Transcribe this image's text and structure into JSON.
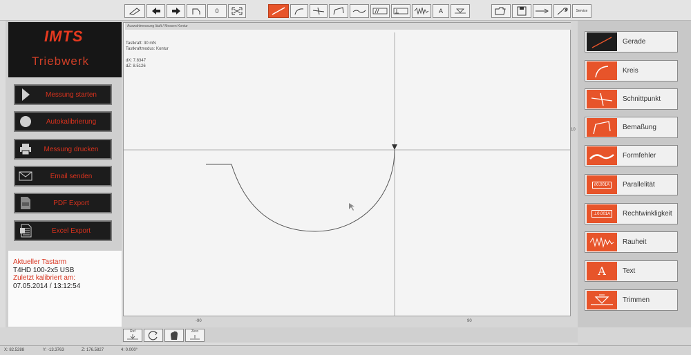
{
  "toolbar": {
    "zero_label": "0",
    "text_tool_label": "A",
    "service_label": "Service"
  },
  "logo": {
    "brand_mark": "IMTS",
    "brand_text": "Triebwerk"
  },
  "sidebar": {
    "buttons": [
      {
        "label": "Messung starten",
        "icon": "play-icon"
      },
      {
        "label": "Autokalibrierung",
        "icon": "circle-icon"
      },
      {
        "label": "Messung drucken",
        "icon": "printer-icon"
      },
      {
        "label": "Email senden",
        "icon": "envelope-icon"
      },
      {
        "label": "PDF Export",
        "icon": "pdf-document-icon"
      },
      {
        "label": "Excel Export",
        "icon": "excel-document-icon"
      }
    ],
    "probe": {
      "label": "Aktueller Tastarm",
      "value": "T4HD 100-2x5 USB",
      "calibrated_label": "Zuletzt kalibriert am:",
      "calibrated_value": "07.05.2014 / 13:12:54"
    }
  },
  "canvas": {
    "title": "Auswahlmessung läuft / Messen Kontur",
    "force": "Tastkraft: 30 mN",
    "mode": "Tastkraftmodus: Kontur",
    "dx": "dX: 7.8347",
    "dz": "dZ: 8.5126",
    "tick_left": "-90",
    "tick_right": "90",
    "tick_side": "10"
  },
  "tools": [
    {
      "label": "Gerade",
      "icon": "line-icon"
    },
    {
      "label": "Kreis",
      "icon": "arc-icon"
    },
    {
      "label": "Schnittpunkt",
      "icon": "intersection-icon"
    },
    {
      "label": "Bemaßung",
      "icon": "dimension-icon"
    },
    {
      "label": "Formfehler",
      "icon": "form-error-icon"
    },
    {
      "label": "Parallelität",
      "icon": "parallelism-icon",
      "icon_text": "//0.001A"
    },
    {
      "label": "Rechtwinkligkeit",
      "icon": "perpendicularity-icon",
      "icon_text": "⊥0.001A"
    },
    {
      "label": "Rauheit",
      "icon": "roughness-icon"
    },
    {
      "label": "Text",
      "icon": "text-icon",
      "icon_text": "A"
    },
    {
      "label": "Trimmen",
      "icon": "trim-icon"
    }
  ],
  "bottom_toolbar": {
    "ref_label": "Ref",
    "zero_label": "Zero"
  },
  "status": {
    "x": "X: 82.5288",
    "y": "Y: -13.3763",
    "z": "Z: 176.5827",
    "angle": "4: 0.000°"
  },
  "colors": {
    "accent": "#e7542a",
    "dark": "#1c1c1c",
    "text_red": "#d8321d"
  }
}
